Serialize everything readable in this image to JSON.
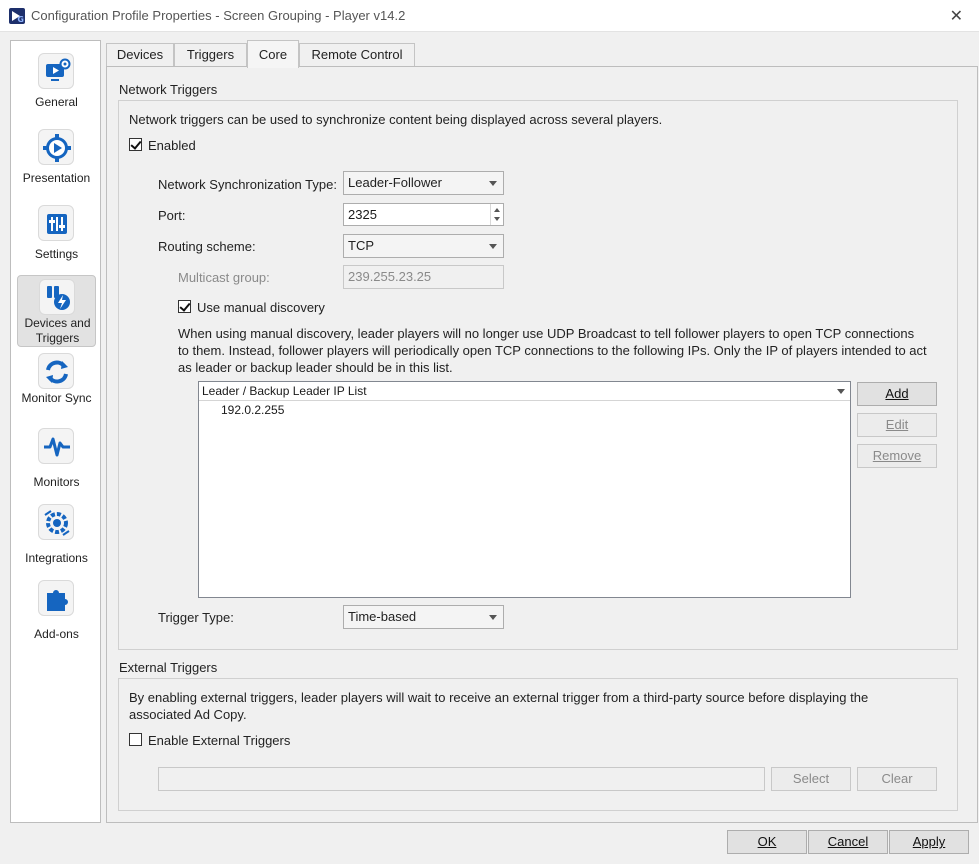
{
  "window": {
    "title": "Configuration Profile Properties - Screen Grouping - Player v14.2"
  },
  "sidebar": {
    "items": [
      {
        "label": "General",
        "icon": "monitor-gear-icon",
        "selected": false
      },
      {
        "label": "Presentation",
        "icon": "play-circle-icon",
        "selected": false
      },
      {
        "label": "Settings",
        "icon": "settings-sliders-icon",
        "selected": false
      },
      {
        "label": "Devices and Triggers",
        "icon": "devices-trigger-icon",
        "selected": true
      },
      {
        "label": "Monitor Sync",
        "icon": "sync-arrows-icon",
        "selected": false
      },
      {
        "label": "Monitors",
        "icon": "heartbeat-icon",
        "selected": false
      },
      {
        "label": "Integrations",
        "icon": "integration-gear-icon",
        "selected": false
      },
      {
        "label": "Add-ons",
        "icon": "puzzle-piece-icon",
        "selected": false
      }
    ]
  },
  "tabs": [
    {
      "label": "Devices",
      "active": false
    },
    {
      "label": "Triggers",
      "active": false
    },
    {
      "label": "Core",
      "active": true
    },
    {
      "label": "Remote Control",
      "active": false
    }
  ],
  "network_triggers": {
    "group_title": "Network Triggers",
    "description": "Network triggers can be used to synchronize content being displayed across several players.",
    "enabled_label": "Enabled",
    "enabled_checked": true,
    "sync_type_label": "Network Synchronization Type:",
    "sync_type_value": "Leader-Follower",
    "port_label": "Port:",
    "port_value": "2325",
    "routing_label": "Routing scheme:",
    "routing_value": "TCP",
    "multicast_label": "Multicast group:",
    "multicast_value": "239.255.23.25",
    "manual_discovery_label": "Use manual discovery",
    "manual_discovery_checked": true,
    "manual_discovery_line1": "When using manual discovery, leader players will no longer use UDP Broadcast to tell follower players to open TCP connections",
    "manual_discovery_line2": "to them. Instead, follower players will periodically open TCP connections to the following IPs. Only the IP of players intended to act",
    "manual_discovery_line3": "as leader or backup leader should be in this list.",
    "ip_list_header": "Leader / Backup Leader IP List",
    "ip_list_rows": [
      "192.0.2.255"
    ],
    "add_button": "Add",
    "edit_button": "Edit",
    "remove_button": "Remove",
    "trigger_type_label": "Trigger Type:",
    "trigger_type_value": "Time-based"
  },
  "external_triggers": {
    "group_title": "External Triggers",
    "description_line1": "By enabling external triggers, leader players will wait to receive an external trigger from a third-party source before displaying the",
    "description_line2": "associated Ad Copy.",
    "enable_label": "Enable External Triggers",
    "enable_checked": false,
    "path_value": "",
    "select_button": "Select",
    "clear_button": "Clear"
  },
  "footer": {
    "ok_button": "OK",
    "cancel_button": "Cancel",
    "apply_button": "Apply"
  },
  "colors": {
    "icon_blue": "#1565c0",
    "selected_nav_bg": "#e2e2e2"
  }
}
